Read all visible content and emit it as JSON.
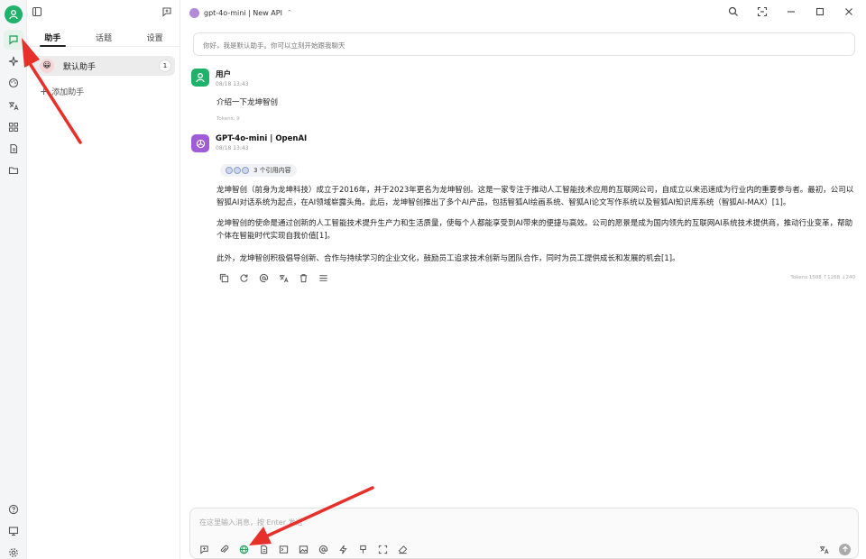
{
  "topbar": {
    "model_label": "gpt-4o-mini | New API",
    "model_chevron": "⌃"
  },
  "panel": {
    "tabs": [
      {
        "label": "助手"
      },
      {
        "label": "话题"
      },
      {
        "label": "设置"
      }
    ],
    "assistant": {
      "emoji": "😀",
      "name": "默认助手",
      "count": "1"
    },
    "add_label": "添加助手"
  },
  "chat": {
    "prompt_text": "你好，我是默认助手。你可以立刻开始跟我聊天",
    "user": {
      "name": "用户",
      "time": "08/18 13:43",
      "text": "介绍一下龙坤智创",
      "tokens": "Tokens: 9"
    },
    "bot": {
      "name": "GPT-4o-mini | OpenAI",
      "time": "08/18 13:43",
      "citation_label": "3 个引用内容",
      "paragraphs": [
        "龙坤智创（前身为龙坤科技）成立于2016年，并于2023年更名为龙坤智创。这是一家专注于推动人工智能技术应用的互联网公司，自成立以来迅速成为行业内的重要参与者。最初，公司以智狐AI对话系统为起点，在AI领域崭露头角。此后，龙坤智创推出了多个AI产品，包括智狐AI绘画系统、智狐AI论文写作系统以及智狐AI知识库系统（智狐AI-MAX）[1]。",
        "龙坤智创的使命是通过创新的人工智能技术提升生产力和生活质量，使每个人都能享受到AI带来的便捷与高效。公司的愿景是成为国内领先的互联网AI系统技术提供商，推动行业变革，帮助个体在智能时代实现自我价值[1]。",
        "此外，龙坤智创积极倡导创新、合作与持续学习的企业文化，鼓励员工追求技术创新与团队合作，同时为员工提供成长和发展的机会[1]。"
      ],
      "tokens": "Tokens:1508 ↑1268 ↓240"
    }
  },
  "input": {
    "placeholder": "在这里输入消息，按 Enter 发送"
  },
  "colors": {
    "accent": "#1a9e52",
    "avatar_green": "#1fb26b",
    "bot_purple": "#a05cd6",
    "arrow_red": "#e8302b"
  }
}
